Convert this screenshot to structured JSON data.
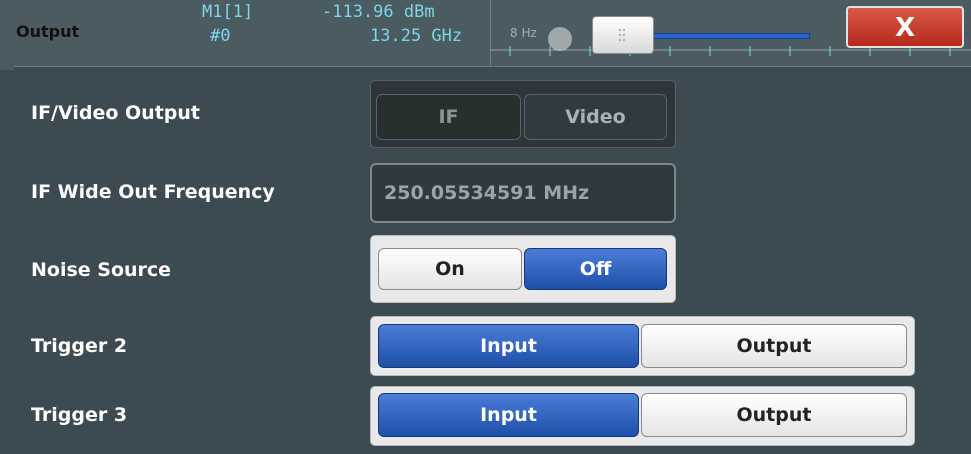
{
  "header": {
    "title": "Output",
    "marker_name": "M1[1]",
    "marker_level": "-113.96 dBm",
    "marker_sub": "#0",
    "marker_freq": "13.25 GHz",
    "slider_label": "8 Hz",
    "close_label": "X"
  },
  "rows": {
    "if_video": {
      "label": "IF/Video Output",
      "options": [
        "IF",
        "Video"
      ],
      "selected": "IF"
    },
    "if_wide": {
      "label": "IF Wide Out Frequency",
      "value": "250.05534591 MHz"
    },
    "noise": {
      "label": "Noise Source",
      "options": [
        "On",
        "Off"
      ],
      "selected": "Off"
    },
    "trigger2": {
      "label": "Trigger 2",
      "options": [
        "Input",
        "Output"
      ],
      "selected": "Input"
    },
    "trigger3": {
      "label": "Trigger 3",
      "options": [
        "Input",
        "Output"
      ],
      "selected": "Input"
    }
  },
  "colors": {
    "accent": "#2b5fc4",
    "close": "#c0392b",
    "panel": "#3c4a51"
  }
}
